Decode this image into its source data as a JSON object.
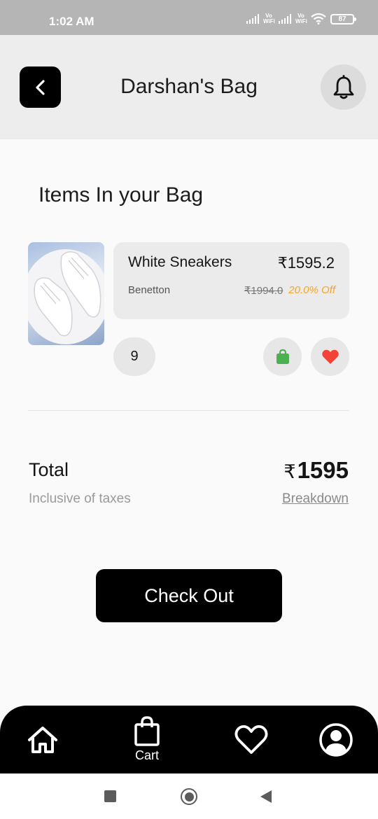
{
  "status_bar": {
    "time": "1:02 AM",
    "network_1": "Vo WiFi",
    "network_2": "Vo WiFi",
    "battery": "87"
  },
  "header": {
    "title": "Darshan's Bag",
    "back_icon": "chevron-left-icon",
    "bell_icon": "bell-icon"
  },
  "bag": {
    "heading": "Items In your Bag",
    "items": [
      {
        "name": "White Sneakers",
        "price": "₹1595.2",
        "brand": "Benetton",
        "original_price": "₹1994.0",
        "discount": "20.0% Off",
        "quantity": "9"
      }
    ]
  },
  "summary": {
    "total_label": "Total",
    "tax_note": "Inclusive of taxes",
    "currency": "₹",
    "total_amount": "1595",
    "breakdown_label": "Breakdown"
  },
  "checkout": {
    "label": "Check Out"
  },
  "bottom_nav": {
    "cart_label": "Cart"
  },
  "colors": {
    "accent": "#000000",
    "discount": "#f5a524",
    "bag_green": "#4caf50",
    "heart_red": "#f44336"
  }
}
